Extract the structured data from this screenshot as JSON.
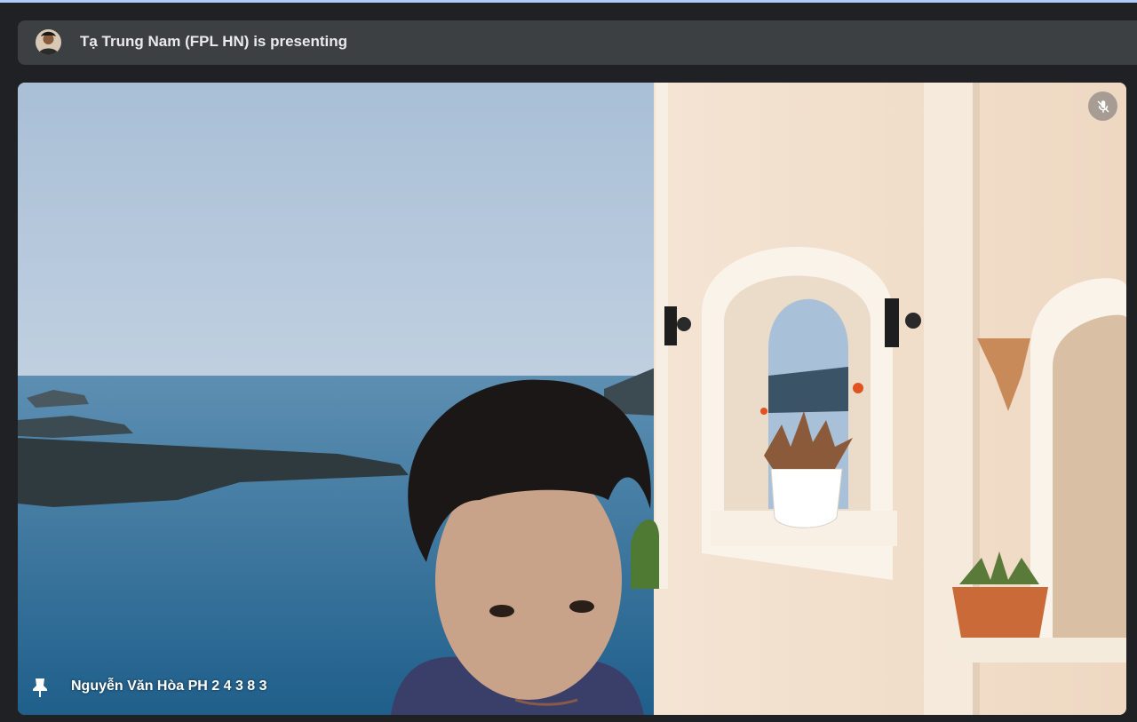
{
  "banner": {
    "presenter_text": "Tạ Trung Nam (FPL HN) is presenting",
    "avatar_icon": "user-avatar"
  },
  "tile": {
    "participant_name": "Nguyễn Văn Hòa PH 2 4 3 8 3",
    "mute_icon": "mic-off-icon",
    "pin_icon": "pin-icon",
    "muted": true
  },
  "colors": {
    "background": "#202124",
    "banner": "#3c4043",
    "accent": "#aecbfa",
    "text": "#e8eaed"
  }
}
